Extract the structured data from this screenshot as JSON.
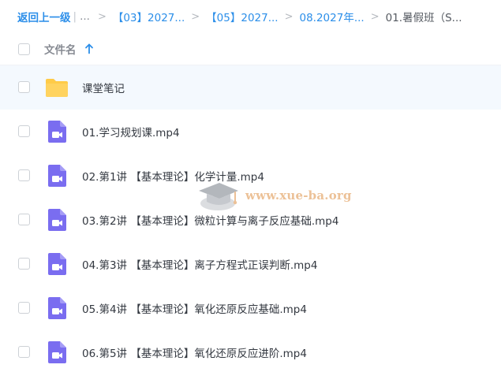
{
  "breadcrumb": {
    "back_label": "返回上一级",
    "divider": "|",
    "ellipsis": "...",
    "items": [
      "【03】2027...",
      "【05】2027...",
      "08.2027年..."
    ],
    "current": "01.暑假班（S...",
    "separator": ">"
  },
  "header": {
    "name_label": "文件名",
    "sort_direction": "ascending"
  },
  "files": [
    {
      "name": "课堂笔记",
      "type": "folder",
      "highlighted": true
    },
    {
      "name": "01.学习规划课.mp4",
      "type": "video"
    },
    {
      "name": "02.第1讲 【基本理论】化学计量.mp4",
      "type": "video"
    },
    {
      "name": "03.第2讲 【基本理论】微粒计算与离子反应基础.mp4",
      "type": "video"
    },
    {
      "name": "04.第3讲 【基本理论】离子方程式正误判断.mp4",
      "type": "video"
    },
    {
      "name": "05.第4讲 【基本理论】氧化还原反应基础.mp4",
      "type": "video"
    },
    {
      "name": "06.第5讲 【基本理论】氧化还原反应进阶.mp4",
      "type": "video"
    }
  ],
  "watermark": {
    "text": "www.xue-ba.org"
  },
  "colors": {
    "link": "#2b8ee9",
    "folder": "#ffcb48",
    "video": "#7a6df0",
    "highlight_row": "#f4f9fe",
    "watermark": "#e7b07a"
  }
}
